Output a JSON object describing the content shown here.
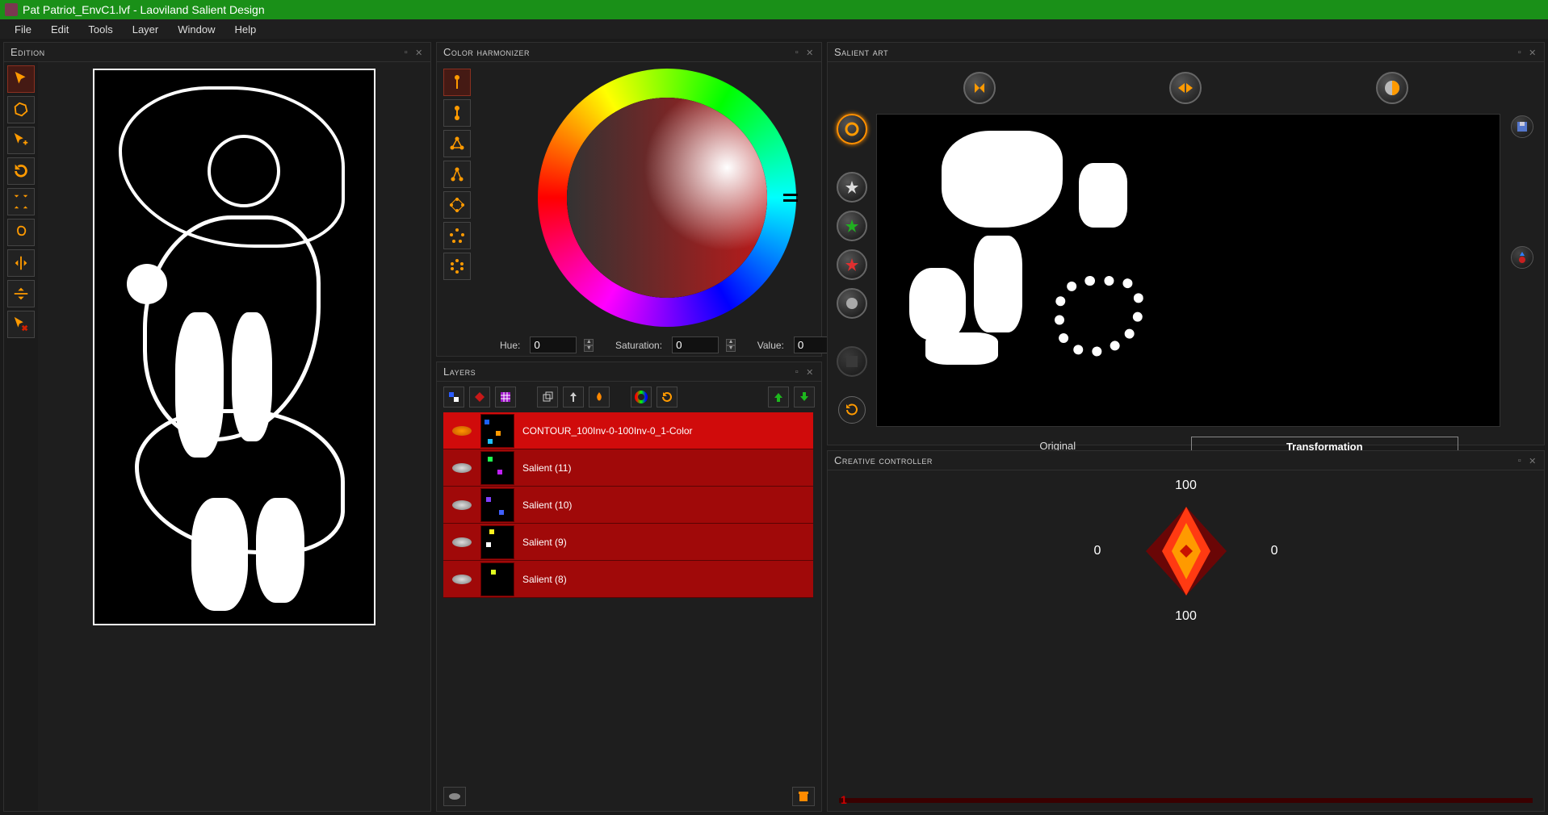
{
  "window": {
    "title": "Pat Patriot_EnvC1.lvf - Laoviland Salient Design"
  },
  "menu": {
    "file": "File",
    "edit": "Edit",
    "tools": "Tools",
    "layer": "Layer",
    "window": "Window",
    "help": "Help"
  },
  "panels": {
    "edition": "Edition",
    "harmonizer": "Color harmonizer",
    "layers": "Layers",
    "salient": "Salient art",
    "creative": "Creative controller"
  },
  "harmonizer": {
    "hue_label": "Hue:",
    "sat_label": "Saturation:",
    "val_label": "Value:",
    "hue": "0",
    "saturation": "0",
    "value": "0"
  },
  "layers": {
    "items": [
      {
        "name": "CONTOUR_100Inv-0-100Inv-0_1-Color",
        "selected": true
      },
      {
        "name": "Salient (11)",
        "selected": false
      },
      {
        "name": "Salient (10)",
        "selected": false
      },
      {
        "name": "Salient (9)",
        "selected": false
      },
      {
        "name": "Salient (8)",
        "selected": false
      }
    ]
  },
  "salient": {
    "tab_original": "Original",
    "tab_transformation": "Transformation"
  },
  "creative": {
    "top": "100",
    "bottom": "100",
    "left": "0",
    "right": "0",
    "slider_value": "1"
  }
}
